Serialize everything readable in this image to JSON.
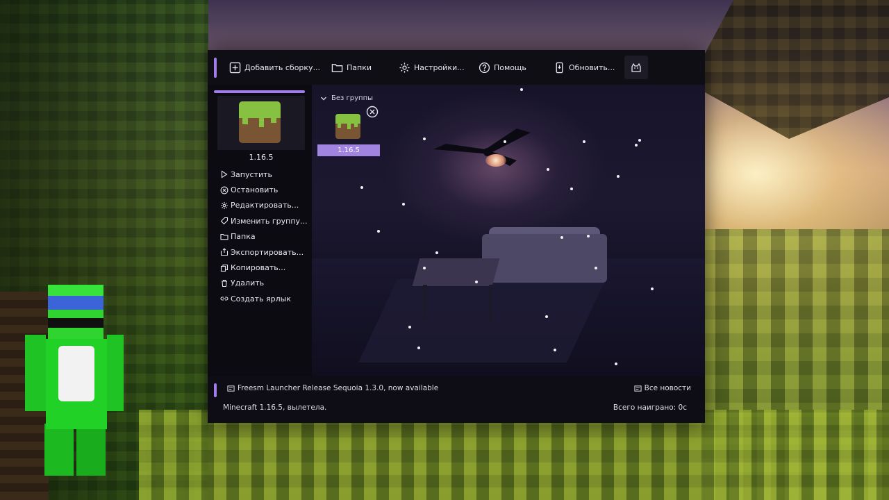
{
  "toolbar": {
    "add_build": "Добавить сборку...",
    "folders": "Папки",
    "settings": "Настройки...",
    "help": "Помощь",
    "update": "Обновить..."
  },
  "sidebar": {
    "version": "1.16.5",
    "actions": [
      {
        "label": "Запустить",
        "icon": "play-icon"
      },
      {
        "label": "Остановить",
        "icon": "stop-icon"
      },
      {
        "label": "Редактировать...",
        "icon": "gear-icon"
      },
      {
        "label": "Изменить группу...",
        "icon": "tag-icon"
      },
      {
        "label": "Папка",
        "icon": "folder-icon"
      },
      {
        "label": "Экспортировать...",
        "icon": "export-icon"
      },
      {
        "label": "Копировать...",
        "icon": "copy-icon"
      },
      {
        "label": "Удалить",
        "icon": "trash-icon"
      },
      {
        "label": "Создать ярлык",
        "icon": "link-icon"
      }
    ]
  },
  "main": {
    "group_name": "Без группы",
    "instances": [
      {
        "name": "1.16.5"
      }
    ]
  },
  "status": {
    "news": "Freesm Launcher Release Sequoia 1.3.0, now available",
    "all_news": "Все новости",
    "crash_message": "Minecraft 1.16.5, вылетела.",
    "play_time": "Всего наиграно: 0с"
  },
  "colors": {
    "accent": "#a27ce8",
    "instance_label_bg": "#a084e0",
    "window_bg": "#0d0c14"
  }
}
